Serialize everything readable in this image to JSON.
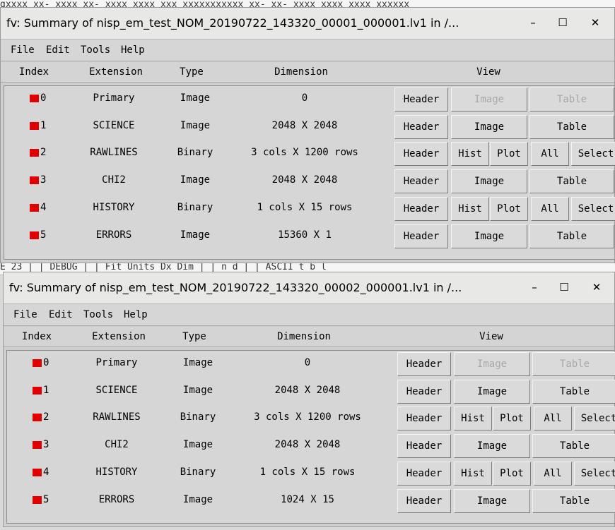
{
  "background": {
    "top_text": "gxxxx xx- xxxx xx- xxxx xxxx xxx xxxxxxxxxxx xx- xx- xxxx xxxx xxxx xxxxxx",
    "middle_text": "E 23  |  |  DEBUG  |  |  Fit Units Dx Dim |  |   n    d  |  |  ASCII t b l"
  },
  "windows": [
    {
      "title": "fv: Summary of nisp_em_test_NOM_20190722_143320_00001_000001.lv1 in /...",
      "controls": {
        "minimize": "–",
        "maximize": "☐",
        "close": "✕"
      },
      "menu": [
        "File",
        "Edit",
        "Tools",
        "Help"
      ],
      "headers": {
        "index": "Index",
        "extension": "Extension",
        "type": "Type",
        "dimension": "Dimension",
        "view": "View"
      },
      "rows": [
        {
          "index": "0",
          "extension": "Primary",
          "type": "Image",
          "dimension": "0",
          "kind": "image_disabled",
          "buttons": [
            "Header",
            "Image",
            "Table"
          ]
        },
        {
          "index": "1",
          "extension": "SCIENCE",
          "type": "Image",
          "dimension": "2048 X 2048",
          "kind": "image",
          "buttons": [
            "Header",
            "Image",
            "Table"
          ]
        },
        {
          "index": "2",
          "extension": "RAWLINES",
          "type": "Binary",
          "dimension": "3 cols X 1200 rows",
          "kind": "binary",
          "buttons": [
            "Header",
            "Hist",
            "Plot",
            "All",
            "Select"
          ]
        },
        {
          "index": "3",
          "extension": "CHI2",
          "type": "Image",
          "dimension": "2048 X 2048",
          "kind": "image",
          "buttons": [
            "Header",
            "Image",
            "Table"
          ]
        },
        {
          "index": "4",
          "extension": "HISTORY",
          "type": "Binary",
          "dimension": "1 cols X 15 rows",
          "kind": "binary",
          "buttons": [
            "Header",
            "Hist",
            "Plot",
            "All",
            "Select"
          ]
        },
        {
          "index": "5",
          "extension": "ERRORS",
          "type": "Image",
          "dimension": "15360 X 1",
          "kind": "image",
          "buttons": [
            "Header",
            "Image",
            "Table"
          ]
        }
      ]
    },
    {
      "title": "fv: Summary of nisp_em_test_NOM_20190722_143320_00002_000001.lv1 in /...",
      "controls": {
        "minimize": "–",
        "maximize": "☐",
        "close": "✕"
      },
      "menu": [
        "File",
        "Edit",
        "Tools",
        "Help"
      ],
      "headers": {
        "index": "Index",
        "extension": "Extension",
        "type": "Type",
        "dimension": "Dimension",
        "view": "View"
      },
      "rows": [
        {
          "index": "0",
          "extension": "Primary",
          "type": "Image",
          "dimension": "0",
          "kind": "image_disabled",
          "buttons": [
            "Header",
            "Image",
            "Table"
          ]
        },
        {
          "index": "1",
          "extension": "SCIENCE",
          "type": "Image",
          "dimension": "2048 X 2048",
          "kind": "image",
          "buttons": [
            "Header",
            "Image",
            "Table"
          ]
        },
        {
          "index": "2",
          "extension": "RAWLINES",
          "type": "Binary",
          "dimension": "3 cols X 1200 rows",
          "kind": "binary",
          "buttons": [
            "Header",
            "Hist",
            "Plot",
            "All",
            "Select"
          ]
        },
        {
          "index": "3",
          "extension": "CHI2",
          "type": "Image",
          "dimension": "2048 X 2048",
          "kind": "image",
          "buttons": [
            "Header",
            "Image",
            "Table"
          ]
        },
        {
          "index": "4",
          "extension": "HISTORY",
          "type": "Binary",
          "dimension": "1 cols X 15 rows",
          "kind": "binary",
          "buttons": [
            "Header",
            "Hist",
            "Plot",
            "All",
            "Select"
          ]
        },
        {
          "index": "5",
          "extension": "ERRORS",
          "type": "Image",
          "dimension": "1024 X 15",
          "kind": "image",
          "buttons": [
            "Header",
            "Image",
            "Table"
          ]
        }
      ]
    }
  ],
  "colors": {
    "index_marker": "#e00000",
    "disabled_text": "#a8a8a8"
  }
}
